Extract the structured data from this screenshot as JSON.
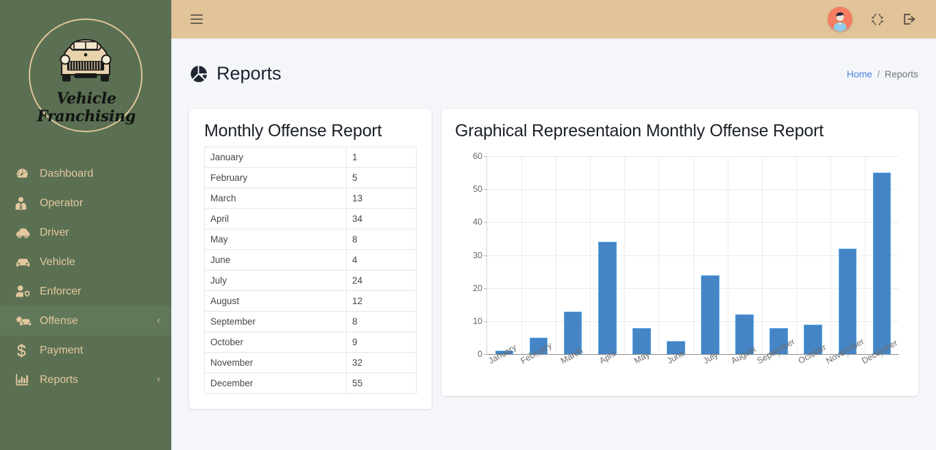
{
  "brand": {
    "name": "Vehicle Franchising",
    "logo_icon": "vintage-car-logo"
  },
  "sidebar": {
    "items": [
      {
        "label": "Dashboard",
        "icon": "gauge-icon",
        "chevron": "",
        "active": false
      },
      {
        "label": "Operator",
        "icon": "user-tie-icon",
        "chevron": "",
        "active": false
      },
      {
        "label": "Driver",
        "icon": "car-side-icon",
        "chevron": "",
        "active": false
      },
      {
        "label": "Vehicle",
        "icon": "car-front-icon",
        "chevron": "",
        "active": false
      },
      {
        "label": "Enforcer",
        "icon": "user-shield-icon",
        "chevron": "",
        "active": false
      },
      {
        "label": "Offense",
        "icon": "car-crash-icon",
        "chevron": "‹",
        "active": true
      },
      {
        "label": "Payment",
        "icon": "dollar-sign-icon",
        "chevron": "",
        "active": false
      },
      {
        "label": "Reports",
        "icon": "chart-bar-icon",
        "chevron": "‹",
        "active": false
      }
    ]
  },
  "topbar": {
    "menu_icon": "hamburger-icon",
    "avatar_icon": "user-avatar",
    "fullscreen_icon": "expand-arrows-icon",
    "logout_icon": "sign-out-icon"
  },
  "page": {
    "title": "Reports",
    "title_icon": "pie-chart-icon",
    "breadcrumb": {
      "home": "Home",
      "separator": "/",
      "current": "Reports"
    }
  },
  "table_card": {
    "title": "Monthly Offense Report",
    "rows": [
      {
        "month": "January",
        "count": "1"
      },
      {
        "month": "February",
        "count": "5"
      },
      {
        "month": "March",
        "count": "13"
      },
      {
        "month": "April",
        "count": "34"
      },
      {
        "month": "May",
        "count": "8"
      },
      {
        "month": "June",
        "count": "4"
      },
      {
        "month": "July",
        "count": "24"
      },
      {
        "month": "August",
        "count": "12"
      },
      {
        "month": "September",
        "count": "8"
      },
      {
        "month": "October",
        "count": "9"
      },
      {
        "month": "November",
        "count": "32"
      },
      {
        "month": "December",
        "count": "55"
      }
    ]
  },
  "chart_card": {
    "title": "Graphical Representaion Monthly Offense Report"
  },
  "chart_data": {
    "type": "bar",
    "title": "Graphical Representaion Monthly Offense Report",
    "categories": [
      "January",
      "February",
      "March",
      "April",
      "May",
      "June",
      "July",
      "August",
      "September",
      "October",
      "Novermber",
      "December"
    ],
    "values": [
      1,
      5,
      13,
      34,
      8,
      4,
      24,
      12,
      8,
      9,
      32,
      55
    ],
    "xlabel": "",
    "ylabel": "",
    "ylim": [
      0,
      60
    ],
    "yticks": [
      0,
      10,
      20,
      30,
      40,
      50,
      60
    ],
    "grid": true,
    "legend": false,
    "bar_color": "#4585c5",
    "bar_border_color": "#5aa7e8"
  },
  "colors": {
    "sidebar_green": "#5b7052",
    "sidebar_text": "#e4c89f",
    "topbar_tan": "#e1c49a",
    "content_bg": "#f4f6f9",
    "link_blue": "#4a7fe0",
    "avatar_bg": "#f47d62"
  }
}
